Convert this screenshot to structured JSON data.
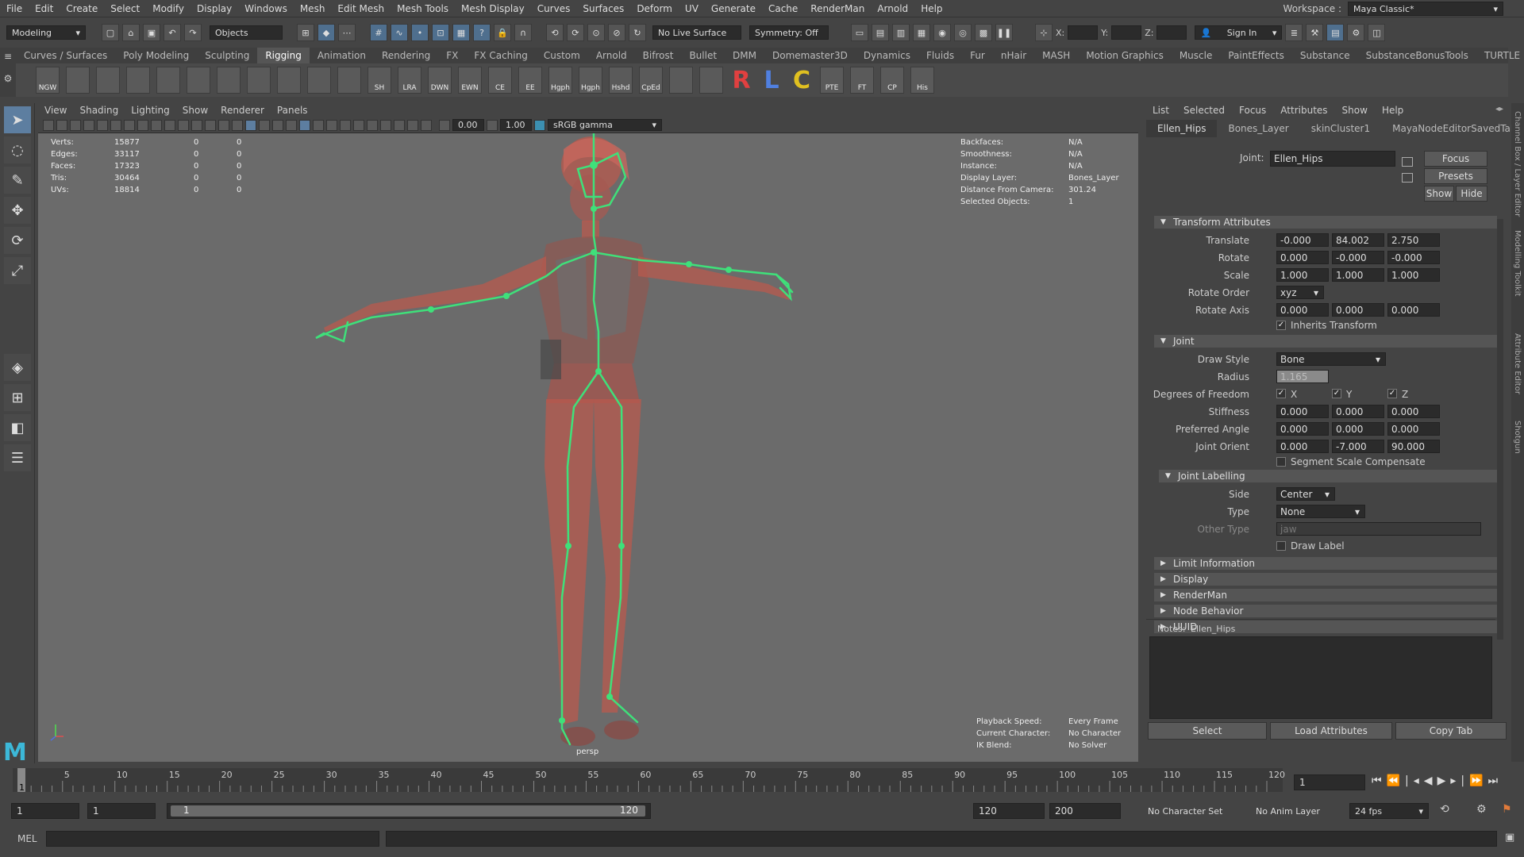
{
  "menubar": {
    "items": [
      "File",
      "Edit",
      "Create",
      "Select",
      "Modify",
      "Display",
      "Windows",
      "Mesh",
      "Edit Mesh",
      "Mesh Tools",
      "Mesh Display",
      "Curves",
      "Surfaces",
      "Deform",
      "UV",
      "Generate",
      "Cache",
      "RenderMan",
      "Arnold",
      "Help"
    ],
    "workspace_label": "Workspace :",
    "workspace_value": "Maya Classic*"
  },
  "statusline": {
    "mode": "Modeling",
    "select_mode": "Objects",
    "live_surface": "No Live Surface",
    "symmetry": "Symmetry: Off",
    "x_label": "X:",
    "y_label": "Y:",
    "z_label": "Z:",
    "sign_in": "Sign In"
  },
  "shelf": {
    "tabs": [
      "Curves / Surfaces",
      "Poly Modeling",
      "Sculpting",
      "Rigging",
      "Animation",
      "Rendering",
      "FX",
      "FX Caching",
      "Custom",
      "Arnold",
      "Bifrost",
      "Bullet",
      "DMM",
      "Domemaster3D",
      "Dynamics",
      "Fluids",
      "Fur",
      "nHair",
      "MASH",
      "Motion Graphics",
      "Muscle",
      "PaintEffects",
      "Substance",
      "SubstanceBonusTools",
      "TURTLE"
    ],
    "active_tab": "Rigging",
    "buttons": [
      "NGW",
      "",
      "",
      "",
      "",
      "",
      "",
      "",
      "",
      "",
      "",
      "SH",
      "LRA",
      "DWN",
      "EWN",
      "CE",
      "EE",
      "Hgph",
      "Hgph",
      "Hshd",
      "CpEd",
      "",
      "",
      "R",
      "L",
      "C",
      "PTE",
      "FT",
      "CP",
      "His"
    ]
  },
  "viewport": {
    "menu": [
      "View",
      "Shading",
      "Lighting",
      "Show",
      "Renderer",
      "Panels"
    ],
    "field_a": "0.00",
    "field_b": "1.00",
    "color_space": "sRGB gamma",
    "camera": "persp",
    "stats": [
      {
        "k": "Verts:",
        "a": "15877",
        "b": "0",
        "c": "0"
      },
      {
        "k": "Edges:",
        "a": "33117",
        "b": "0",
        "c": "0"
      },
      {
        "k": "Faces:",
        "a": "17323",
        "b": "0",
        "c": "0"
      },
      {
        "k": "Tris:",
        "a": "30464",
        "b": "0",
        "c": "0"
      },
      {
        "k": "UVs:",
        "a": "18814",
        "b": "0",
        "c": "0"
      }
    ],
    "info": [
      {
        "k": "Backfaces:",
        "v": "N/A"
      },
      {
        "k": "Smoothness:",
        "v": "N/A"
      },
      {
        "k": "Instance:",
        "v": "N/A"
      },
      {
        "k": "Display Layer:",
        "v": "Bones_Layer"
      },
      {
        "k": "Distance From Camera:",
        "v": "301.24"
      },
      {
        "k": "Selected Objects:",
        "v": "1"
      }
    ],
    "playback": [
      {
        "k": "Playback Speed:",
        "v": "Every Frame"
      },
      {
        "k": "Current Character:",
        "v": "No Character"
      },
      {
        "k": "IK Blend:",
        "v": "No Solver"
      }
    ]
  },
  "ae": {
    "menu": [
      "List",
      "Selected",
      "Focus",
      "Attributes",
      "Show",
      "Help"
    ],
    "tabs": [
      "Ellen_Hips",
      "Bones_Layer",
      "skinCluster1",
      "MayaNodeEditorSavedTabs"
    ],
    "joint_label": "Joint:",
    "joint_name": "Ellen_Hips",
    "focus": "Focus",
    "presets": "Presets",
    "show": "Show",
    "hide": "Hide",
    "transform_title": "Transform Attributes",
    "translate_label": "Translate",
    "translate": [
      "-0.000",
      "84.002",
      "2.750"
    ],
    "rotate_label": "Rotate",
    "rotate": [
      "0.000",
      "-0.000",
      "-0.000"
    ],
    "scale_label": "Scale",
    "scale": [
      "1.000",
      "1.000",
      "1.000"
    ],
    "rotate_order_label": "Rotate Order",
    "rotate_order": "xyz",
    "rotate_axis_label": "Rotate Axis",
    "rotate_axis": [
      "0.000",
      "0.000",
      "0.000"
    ],
    "inherits": "Inherits Transform",
    "joint_title": "Joint",
    "draw_style_label": "Draw Style",
    "draw_style": "Bone",
    "radius_label": "Radius",
    "radius": "1.165",
    "dof_label": "Degrees of Freedom",
    "dof": [
      "X",
      "Y",
      "Z"
    ],
    "stiffness_label": "Stiffness",
    "stiffness": [
      "0.000",
      "0.000",
      "0.000"
    ],
    "pref_label": "Preferred Angle",
    "pref": [
      "0.000",
      "0.000",
      "0.000"
    ],
    "orient_label": "Joint Orient",
    "orient": [
      "0.000",
      "-7.000",
      "90.000"
    ],
    "ssc": "Segment Scale Compensate",
    "labelling_title": "Joint Labelling",
    "side_label": "Side",
    "side": "Center",
    "type_label": "Type",
    "type": "None",
    "other_type_label": "Other Type",
    "other_type": "jaw",
    "draw_label": "Draw Label",
    "collapsed": [
      "Limit Information",
      "Display",
      "RenderMan",
      "Node Behavior",
      "UUID"
    ],
    "notes_label": "Notes:",
    "notes_name": "Ellen_Hips",
    "select_btn": "Select",
    "load_btn": "Load Attributes",
    "copy_btn": "Copy Tab"
  },
  "sidetabs": [
    "Channel Box / Layer Editor",
    "Modelling Toolkit",
    "Attribute Editor",
    "Shotgun"
  ],
  "timeline": {
    "ticks": [
      "5",
      "10",
      "15",
      "20",
      "25",
      "30",
      "35",
      "40",
      "45",
      "50",
      "55",
      "60",
      "65",
      "70",
      "75",
      "80",
      "85",
      "90",
      "95",
      "100",
      "105",
      "110",
      "115",
      "120"
    ],
    "current": "1",
    "frame_field": "1"
  },
  "range": {
    "start": "1",
    "start2": "1",
    "slider_start": "1",
    "slider_end": "120",
    "end": "120",
    "end2": "200",
    "char_set": "No Character Set",
    "anim_layer": "No Anim Layer",
    "fps": "24 fps"
  },
  "cmd": {
    "lang": "MEL"
  }
}
